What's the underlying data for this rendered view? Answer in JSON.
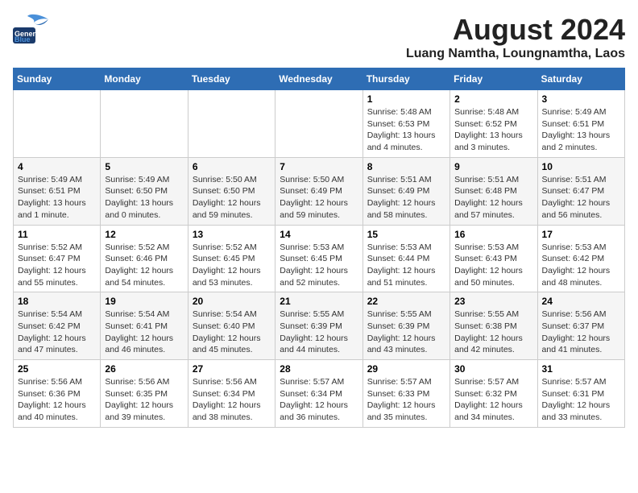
{
  "logo": {
    "line1": "General",
    "line2": "Blue"
  },
  "title": "August 2024",
  "location": "Luang Namtha, Loungnamtha, Laos",
  "days_of_week": [
    "Sunday",
    "Monday",
    "Tuesday",
    "Wednesday",
    "Thursday",
    "Friday",
    "Saturday"
  ],
  "weeks": [
    [
      {
        "day": "",
        "info": ""
      },
      {
        "day": "",
        "info": ""
      },
      {
        "day": "",
        "info": ""
      },
      {
        "day": "",
        "info": ""
      },
      {
        "day": "1",
        "info": "Sunrise: 5:48 AM\nSunset: 6:53 PM\nDaylight: 13 hours\nand 4 minutes."
      },
      {
        "day": "2",
        "info": "Sunrise: 5:48 AM\nSunset: 6:52 PM\nDaylight: 13 hours\nand 3 minutes."
      },
      {
        "day": "3",
        "info": "Sunrise: 5:49 AM\nSunset: 6:51 PM\nDaylight: 13 hours\nand 2 minutes."
      }
    ],
    [
      {
        "day": "4",
        "info": "Sunrise: 5:49 AM\nSunset: 6:51 PM\nDaylight: 13 hours\nand 1 minute."
      },
      {
        "day": "5",
        "info": "Sunrise: 5:49 AM\nSunset: 6:50 PM\nDaylight: 13 hours\nand 0 minutes."
      },
      {
        "day": "6",
        "info": "Sunrise: 5:50 AM\nSunset: 6:50 PM\nDaylight: 12 hours\nand 59 minutes."
      },
      {
        "day": "7",
        "info": "Sunrise: 5:50 AM\nSunset: 6:49 PM\nDaylight: 12 hours\nand 59 minutes."
      },
      {
        "day": "8",
        "info": "Sunrise: 5:51 AM\nSunset: 6:49 PM\nDaylight: 12 hours\nand 58 minutes."
      },
      {
        "day": "9",
        "info": "Sunrise: 5:51 AM\nSunset: 6:48 PM\nDaylight: 12 hours\nand 57 minutes."
      },
      {
        "day": "10",
        "info": "Sunrise: 5:51 AM\nSunset: 6:47 PM\nDaylight: 12 hours\nand 56 minutes."
      }
    ],
    [
      {
        "day": "11",
        "info": "Sunrise: 5:52 AM\nSunset: 6:47 PM\nDaylight: 12 hours\nand 55 minutes."
      },
      {
        "day": "12",
        "info": "Sunrise: 5:52 AM\nSunset: 6:46 PM\nDaylight: 12 hours\nand 54 minutes."
      },
      {
        "day": "13",
        "info": "Sunrise: 5:52 AM\nSunset: 6:45 PM\nDaylight: 12 hours\nand 53 minutes."
      },
      {
        "day": "14",
        "info": "Sunrise: 5:53 AM\nSunset: 6:45 PM\nDaylight: 12 hours\nand 52 minutes."
      },
      {
        "day": "15",
        "info": "Sunrise: 5:53 AM\nSunset: 6:44 PM\nDaylight: 12 hours\nand 51 minutes."
      },
      {
        "day": "16",
        "info": "Sunrise: 5:53 AM\nSunset: 6:43 PM\nDaylight: 12 hours\nand 50 minutes."
      },
      {
        "day": "17",
        "info": "Sunrise: 5:53 AM\nSunset: 6:42 PM\nDaylight: 12 hours\nand 48 minutes."
      }
    ],
    [
      {
        "day": "18",
        "info": "Sunrise: 5:54 AM\nSunset: 6:42 PM\nDaylight: 12 hours\nand 47 minutes."
      },
      {
        "day": "19",
        "info": "Sunrise: 5:54 AM\nSunset: 6:41 PM\nDaylight: 12 hours\nand 46 minutes."
      },
      {
        "day": "20",
        "info": "Sunrise: 5:54 AM\nSunset: 6:40 PM\nDaylight: 12 hours\nand 45 minutes."
      },
      {
        "day": "21",
        "info": "Sunrise: 5:55 AM\nSunset: 6:39 PM\nDaylight: 12 hours\nand 44 minutes."
      },
      {
        "day": "22",
        "info": "Sunrise: 5:55 AM\nSunset: 6:39 PM\nDaylight: 12 hours\nand 43 minutes."
      },
      {
        "day": "23",
        "info": "Sunrise: 5:55 AM\nSunset: 6:38 PM\nDaylight: 12 hours\nand 42 minutes."
      },
      {
        "day": "24",
        "info": "Sunrise: 5:56 AM\nSunset: 6:37 PM\nDaylight: 12 hours\nand 41 minutes."
      }
    ],
    [
      {
        "day": "25",
        "info": "Sunrise: 5:56 AM\nSunset: 6:36 PM\nDaylight: 12 hours\nand 40 minutes."
      },
      {
        "day": "26",
        "info": "Sunrise: 5:56 AM\nSunset: 6:35 PM\nDaylight: 12 hours\nand 39 minutes."
      },
      {
        "day": "27",
        "info": "Sunrise: 5:56 AM\nSunset: 6:34 PM\nDaylight: 12 hours\nand 38 minutes."
      },
      {
        "day": "28",
        "info": "Sunrise: 5:57 AM\nSunset: 6:34 PM\nDaylight: 12 hours\nand 36 minutes."
      },
      {
        "day": "29",
        "info": "Sunrise: 5:57 AM\nSunset: 6:33 PM\nDaylight: 12 hours\nand 35 minutes."
      },
      {
        "day": "30",
        "info": "Sunrise: 5:57 AM\nSunset: 6:32 PM\nDaylight: 12 hours\nand 34 minutes."
      },
      {
        "day": "31",
        "info": "Sunrise: 5:57 AM\nSunset: 6:31 PM\nDaylight: 12 hours\nand 33 minutes."
      }
    ]
  ]
}
